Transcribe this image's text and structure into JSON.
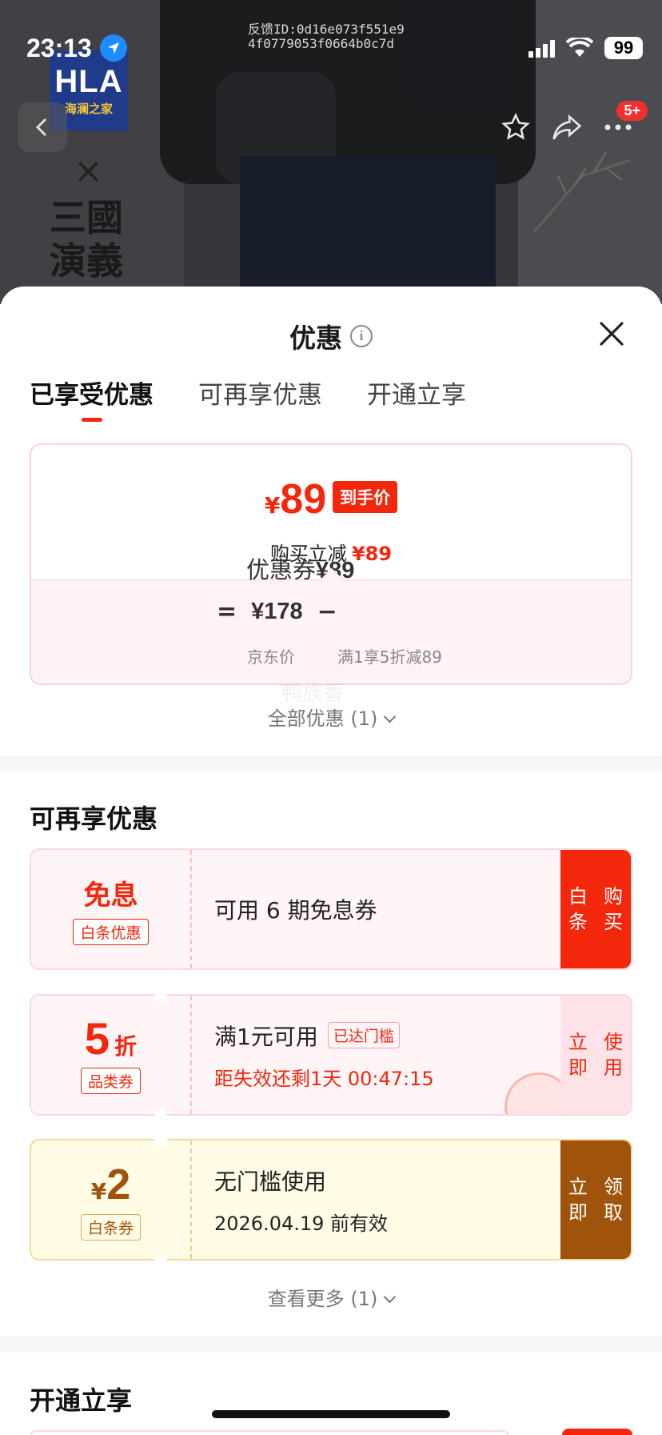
{
  "status_bar": {
    "time": "23:13",
    "battery": "99",
    "feedback_line1": "反馈ID:0d16e073f551e9",
    "feedback_line2": "4f0779053f0664b0c7d"
  },
  "product_bg": {
    "brand_big": "HLA",
    "brand_small": "海澜之家",
    "cross": "×",
    "collab_line1": "三國",
    "collab_line2": "演義",
    "cart_badge": "5+"
  },
  "sheet": {
    "title": "优惠",
    "info_glyph": "i"
  },
  "tabs": [
    {
      "label": "已享受优惠",
      "active": true
    },
    {
      "label": "可再享优惠",
      "active": false
    },
    {
      "label": "开通立享",
      "active": false
    }
  ],
  "price_card": {
    "currency": "¥",
    "final_price": "89",
    "final_tag": "到手价",
    "reduce_label": "购买立减",
    "reduce_amount": "¥89",
    "equals": "=",
    "jd_price": "¥178",
    "minus": "−",
    "coupon_label": "优惠券",
    "coupon_amount": "¥89",
    "jd_price_label": "京东价",
    "coupon_rule": "满1享5折减89"
  },
  "watermark": "鸭族香",
  "all_offers": "全部优惠 (1)",
  "section_more": {
    "title": "可再享优惠",
    "coupons": [
      {
        "big": "免息",
        "chip": "白条优惠",
        "line1": "可用 6 期免息券",
        "action": "白条购买"
      },
      {
        "big": "5",
        "unit": "折",
        "chip": "品类券",
        "line1": "满1元可用",
        "status": "已达门槛",
        "line2": "距失效还剩1天 00:47:15",
        "action": "立即使用"
      },
      {
        "currency": "¥",
        "big": "2",
        "chip": "白条券",
        "line1": "无门槛使用",
        "line2": "2026.04.19 前有效",
        "action": "立即领取"
      }
    ],
    "see_more": "查看更多 (1)"
  },
  "section_open": {
    "title": "开通立享"
  },
  "colors": {
    "accent": "#f2270c",
    "gold": "#a0540b",
    "pink_bg": "#fff5f6",
    "yellow_bg": "#fffbe5"
  },
  "icons": [
    "location-arrow-icon",
    "cellular-signal-icon",
    "wifi-icon",
    "back-arrow-icon",
    "star-icon",
    "share-icon",
    "more-icon",
    "info-icon",
    "close-icon",
    "chevron-down-icon"
  ]
}
